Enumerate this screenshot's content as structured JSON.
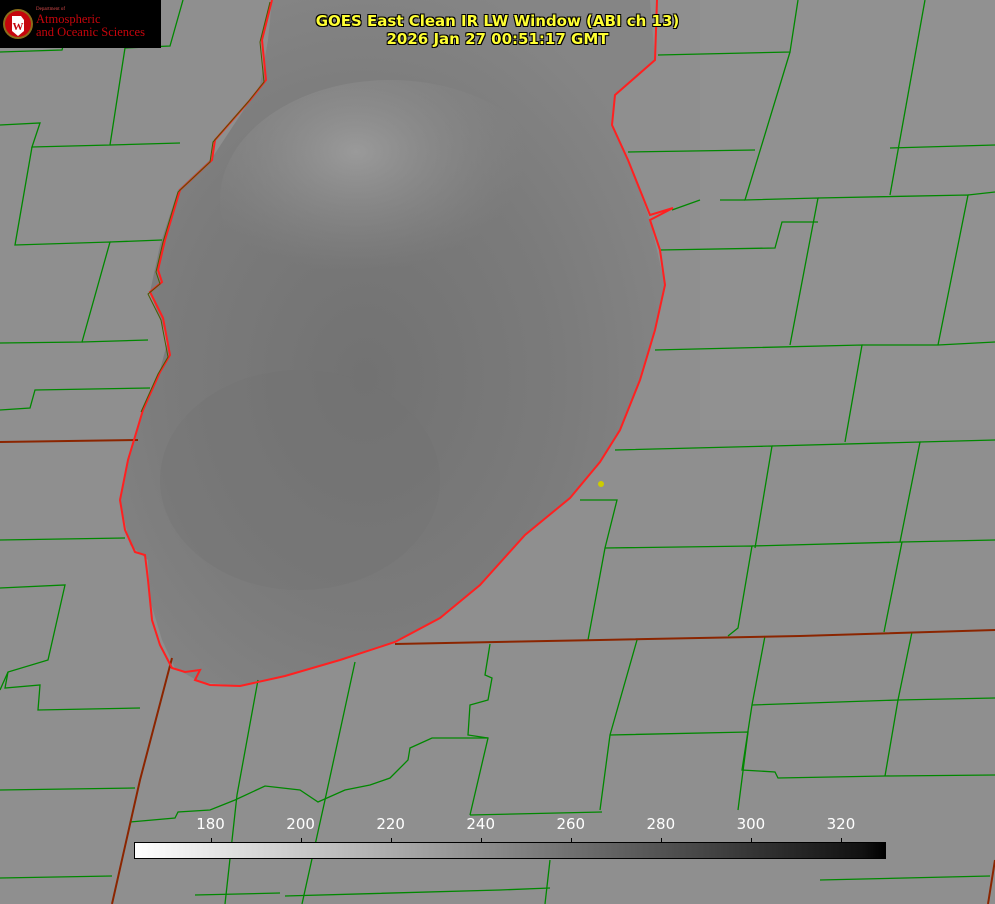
{
  "header": {
    "title_line1": "GOES East Clean IR LW Window (ABI ch 13)",
    "title_line2": "2026 Jan 27 00:51:17 GMT"
  },
  "logo": {
    "department_line": "Department of",
    "name_line1": "Atmospheric",
    "name_line2": "and Oceanic Sciences",
    "crest_letter": "W"
  },
  "colorbar": {
    "min": 163,
    "max": 330,
    "gradient": "white-to-black",
    "tick_labels": [
      "180",
      "200",
      "220",
      "240",
      "260",
      "280",
      "300",
      "320"
    ],
    "tick_values": [
      180,
      200,
      220,
      240,
      260,
      280,
      300,
      320
    ]
  },
  "colors": {
    "background_gray": "#8f8f8f",
    "lake_gray": "#7a7a7a",
    "county_lines": "#008800",
    "state_lines": "#8b2500",
    "shoreline": "#ff2020",
    "title_text": "#ffff33",
    "station_marker": "#cccc00"
  }
}
